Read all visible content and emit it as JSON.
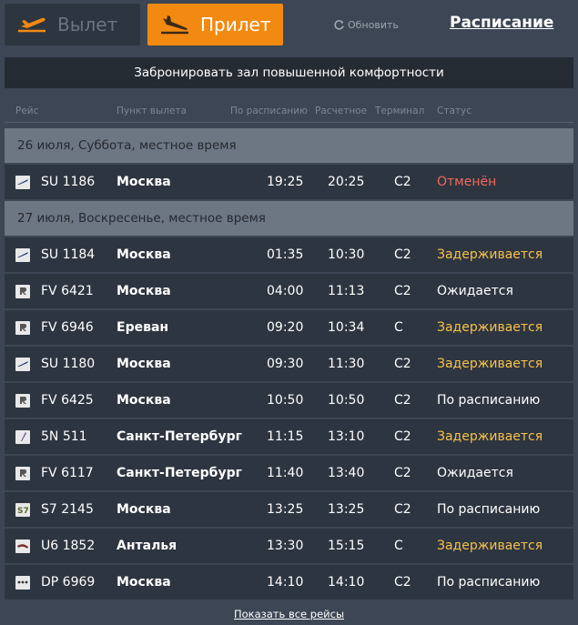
{
  "tabs": {
    "departure": "Вылет",
    "arrival": "Прилет"
  },
  "refresh": "Обновить",
  "schedule": "Расписание",
  "banner": "Забронировать зал повышенной комфортности",
  "columns": {
    "flight": "Рейс",
    "origin": "Пункт вылета",
    "scheduled": "По расписанию",
    "estimated": "Расчетное",
    "terminal": "Терминал",
    "status": "Статус"
  },
  "day1": "26 июля, Суббота, местное время",
  "day2": "27 июля, Воскресенье, местное время",
  "flights": [
    {
      "icon": "aeroflot-logo-icon",
      "flight": "SU 1186",
      "city": "Москва",
      "sch": "19:25",
      "est": "20:25",
      "term": "C2",
      "status": "Отменён"
    },
    {
      "icon": "aeroflot-logo-icon",
      "flight": "SU 1184",
      "city": "Москва",
      "sch": "01:35",
      "est": "10:30",
      "term": "C2",
      "status": "Задерживается"
    },
    {
      "icon": "rossiya-logo-icon",
      "flight": "FV 6421",
      "city": "Москва",
      "sch": "04:00",
      "est": "11:13",
      "term": "C2",
      "status": "Ожидается"
    },
    {
      "icon": "rossiya-logo-icon",
      "flight": "FV 6946",
      "city": "Ереван",
      "sch": "09:20",
      "est": "10:34",
      "term": "C",
      "status": "Задерживается"
    },
    {
      "icon": "aeroflot-logo-icon",
      "flight": "SU 1180",
      "city": "Москва",
      "sch": "09:30",
      "est": "11:30",
      "term": "C2",
      "status": "Задерживается"
    },
    {
      "icon": "rossiya-logo-icon",
      "flight": "FV 6425",
      "city": "Москва",
      "sch": "10:50",
      "est": "10:50",
      "term": "C2",
      "status": "По расписанию"
    },
    {
      "icon": "smartavia-logo-icon",
      "flight": "5N 511",
      "city": "Санкт-Петербург",
      "sch": "11:15",
      "est": "13:10",
      "term": "C2",
      "status": "Задерживается"
    },
    {
      "icon": "rossiya-logo-icon",
      "flight": "FV 6117",
      "city": "Санкт-Петербург",
      "sch": "11:40",
      "est": "13:40",
      "term": "C2",
      "status": "Ожидается"
    },
    {
      "icon": "s7-logo-icon",
      "flight": "S7 2145",
      "city": "Москва",
      "sch": "13:25",
      "est": "13:25",
      "term": "C2",
      "status": "По расписанию"
    },
    {
      "icon": "uralairlines-logo-icon",
      "flight": "U6 1852",
      "city": "Анталья",
      "sch": "13:30",
      "est": "15:15",
      "term": "C",
      "status": "Задерживается"
    },
    {
      "icon": "pobeda-logo-icon",
      "flight": "DP 6969",
      "city": "Москва",
      "sch": "14:10",
      "est": "14:10",
      "term": "C2",
      "status": "По расписанию"
    }
  ],
  "show_all": "Показать все рейсы",
  "colors": {
    "accent": "#f28a11",
    "cancelled": "#f06a5a",
    "delayed": "#f7c14a"
  }
}
